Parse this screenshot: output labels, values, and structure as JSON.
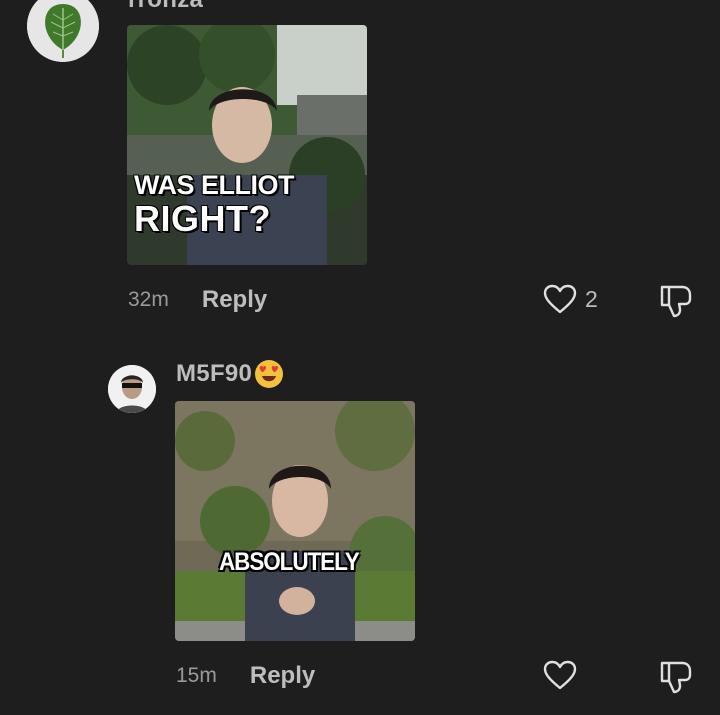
{
  "comments": [
    {
      "username": "rronza",
      "avatar": "leaf-icon",
      "image_caption_line1": "WAS ELLIOT",
      "image_caption_line2": "RIGHT?",
      "time": "32m",
      "reply_label": "Reply",
      "like_count": "2"
    },
    {
      "username": "M5F90",
      "username_emoji": "heart-eyes-emoji",
      "avatar": "person-photo",
      "image_caption": "ABSOLUTELY",
      "time": "15m",
      "reply_label": "Reply",
      "like_count": ""
    }
  ],
  "colors": {
    "background": "#1e1e1e",
    "text_muted": "#9a9a9a",
    "text": "#bdbdbd"
  }
}
